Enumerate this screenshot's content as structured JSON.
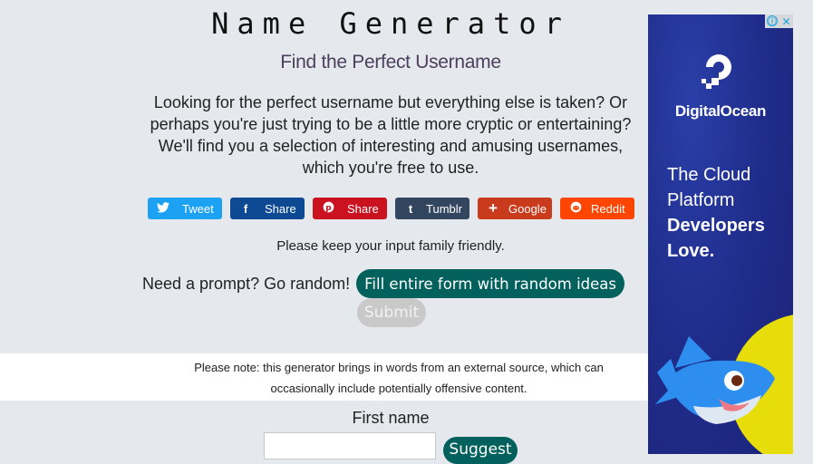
{
  "header": {
    "title": "Name Generator",
    "subtitle": "Find the Perfect Username"
  },
  "intro": "Looking for the perfect username but everything else is taken? Or perhaps you're just trying to be a little more cryptic or entertaining? We'll find you a selection of interesting and amusing usernames, which you're free to use.",
  "share": {
    "buttons": [
      {
        "label": "Tweet",
        "icon": "twitter-icon",
        "glyph": "🐦",
        "color": "#1da1f2"
      },
      {
        "label": "Share",
        "icon": "facebook-icon",
        "glyph": "f",
        "color": "#0d4a93"
      },
      {
        "label": "Share",
        "icon": "pinterest-icon",
        "glyph": "℗",
        "color": "#cb1220"
      },
      {
        "label": "Tumblr",
        "icon": "tumblr-icon",
        "glyph": "t",
        "color": "#32465f"
      },
      {
        "label": "Google",
        "icon": "google-plus-icon",
        "glyph": "+",
        "color": "#c93b1c"
      },
      {
        "label": "Reddit",
        "icon": "reddit-icon",
        "glyph": "●",
        "color": "#fe4502"
      }
    ]
  },
  "family_notice": "Please keep your input family friendly.",
  "prompt": {
    "text": "Need a prompt? Go random!",
    "random_button": "Fill entire form with random ideas",
    "submit_button": "Submit"
  },
  "note": "Please note: this generator brings in words from an external source, which can occasionally include potentially offensive content.",
  "form": {
    "first_name_label": "First name",
    "first_name_value": "",
    "suggest_button": "Suggest"
  },
  "ad": {
    "info_icon": "ⓘ",
    "close_icon": "✕",
    "brand": "DigitalOcean",
    "tagline_line1": "The Cloud",
    "tagline_line2": "Platform",
    "tagline_line3": "Developers",
    "tagline_line4": "Love."
  },
  "colors": {
    "accent": "#02615c",
    "background": "#e5e8ed",
    "submit_disabled": "#c9c9c9"
  }
}
